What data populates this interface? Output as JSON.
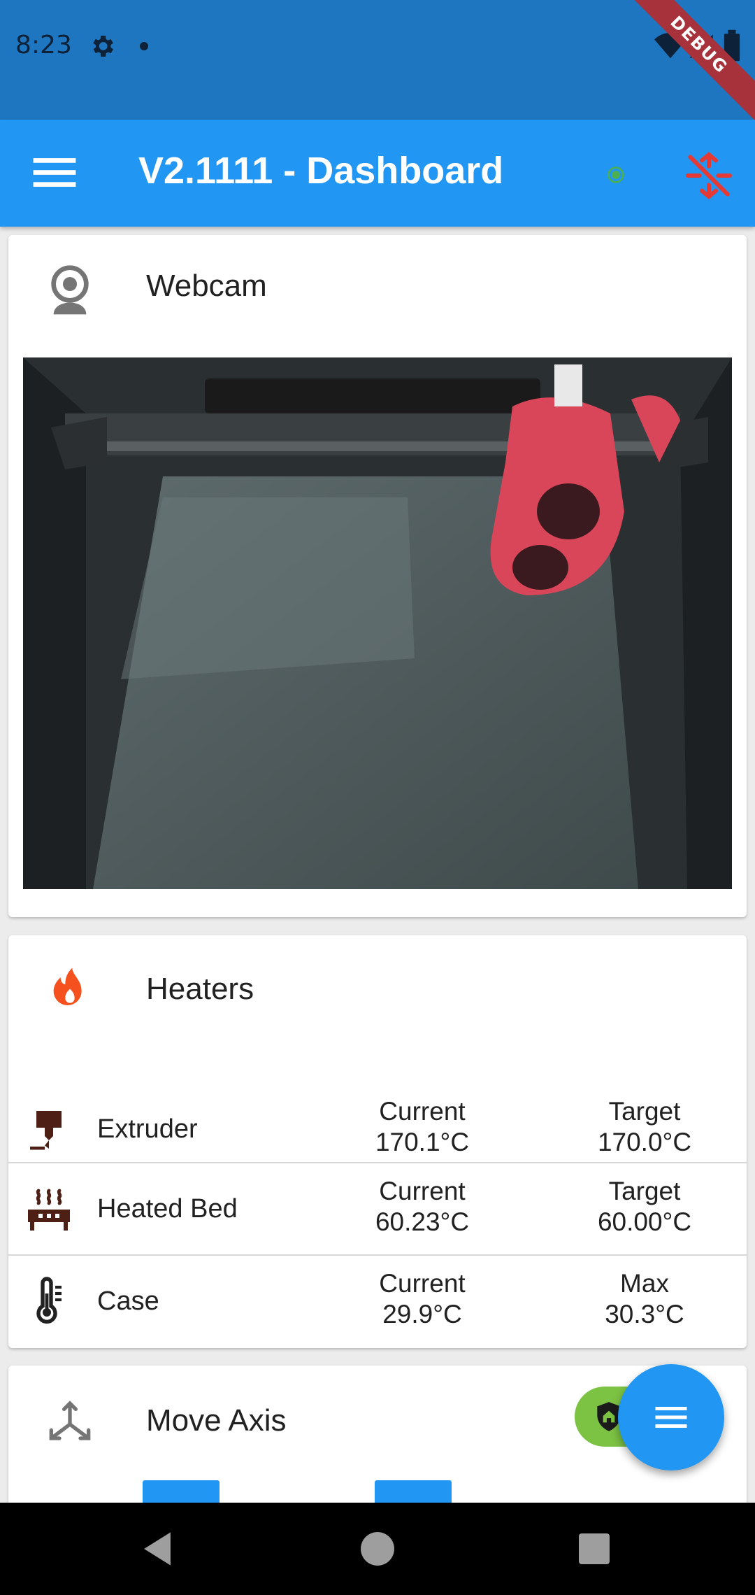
{
  "status_bar": {
    "time": "8:23",
    "icons": [
      "gear-icon",
      "notification-dot-icon",
      "wifi-icon",
      "signal-icon",
      "battery-icon"
    ],
    "debug_banner": "DEBUG"
  },
  "app_bar": {
    "title": "V2.1111 - Dashboard",
    "menu_icon": "menu-icon",
    "connection_status_color": "#4caf50",
    "disconnect_icon": "network-off-icon",
    "disconnect_icon_color": "#e53935"
  },
  "webcam": {
    "title": "Webcam",
    "icon": "webcam-icon"
  },
  "heaters": {
    "title": "Heaters",
    "icon": "fire-icon",
    "icon_color": "#f4511e",
    "rows": [
      {
        "name": "Extruder",
        "icon": "extruder-icon",
        "col1_label": "Current",
        "col1_value": "170.1°C",
        "col2_label": "Target",
        "col2_value": "170.0°C"
      },
      {
        "name": "Heated Bed",
        "icon": "heated-bed-icon",
        "col1_label": "Current",
        "col1_value": "60.23°C",
        "col2_label": "Target",
        "col2_value": "60.00°C"
      },
      {
        "name": "Case",
        "icon": "thermometer-icon",
        "col1_label": "Current",
        "col1_value": "29.9°C",
        "col2_label": "Max",
        "col2_value": "30.3°C"
      }
    ]
  },
  "move_axis": {
    "title": "Move Axis",
    "icon": "axis-arrows-icon",
    "homed_chip_icon": "home-shield-icon",
    "homed_chip_color": "#7cc243"
  },
  "fab": {
    "icon": "menu-icon"
  },
  "nav_bar": {
    "icons": [
      "back-icon",
      "home-icon",
      "recents-icon"
    ]
  },
  "colors": {
    "primary": "#2196f3",
    "status_bar": "#1e76c0"
  }
}
